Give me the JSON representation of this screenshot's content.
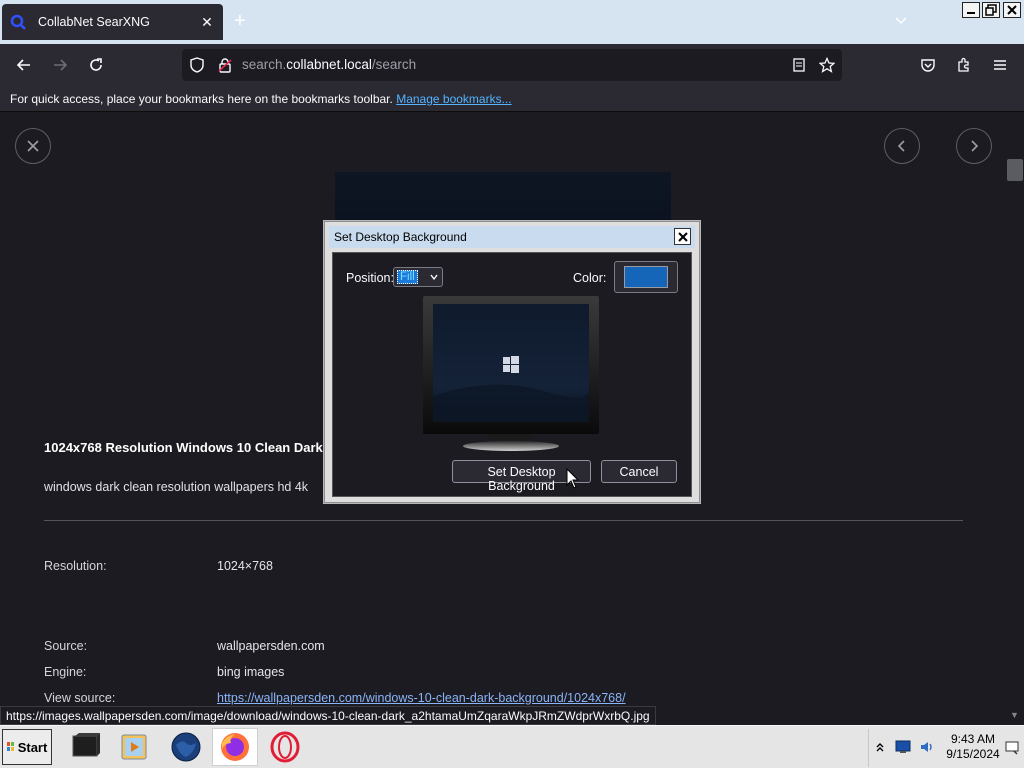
{
  "browser": {
    "tab_title": "CollabNet SearXNG",
    "url_prefix": "search.",
    "url_domain": "collabnet.local",
    "url_path": "/search",
    "bookmarks_message": "For quick access, place your bookmarks here on the bookmarks toolbar.",
    "bookmarks_link": "Manage bookmarks..."
  },
  "result": {
    "title": "1024x768 Resolution Windows 10 Clean Dark",
    "description": "windows dark clean resolution wallpapers hd 4k",
    "fields": [
      {
        "label": "Resolution:",
        "value": "1024×768"
      },
      {
        "label": "Source:",
        "value": "wallpapersden.com"
      },
      {
        "label": "Engine:",
        "value": "bing images"
      },
      {
        "label": "View source:",
        "value": "https://wallpapersden.com/windows-10-clean-dark-background/1024x768/"
      }
    ]
  },
  "status_url": "https://images.wallpapersden.com/image/download/windows-10-clean-dark_a2htamaUmZqaraWkpJRmZWdprWxrbQ.jpg",
  "dialog": {
    "title": "Set Desktop Background",
    "position_label": "Position:",
    "position_value": "Fill",
    "color_label": "Color:",
    "color_value": "#1565b8",
    "set_button": "Set Desktop Background",
    "cancel_button": "Cancel"
  },
  "taskbar": {
    "start_label": "Start",
    "time": "9:43 AM",
    "date": "9/15/2024"
  },
  "colors": {
    "browser_bg": "#1c1b22",
    "toolbar": "#2b2a33",
    "link": "#54b4ff",
    "accent_blue": "#1a79d9"
  }
}
